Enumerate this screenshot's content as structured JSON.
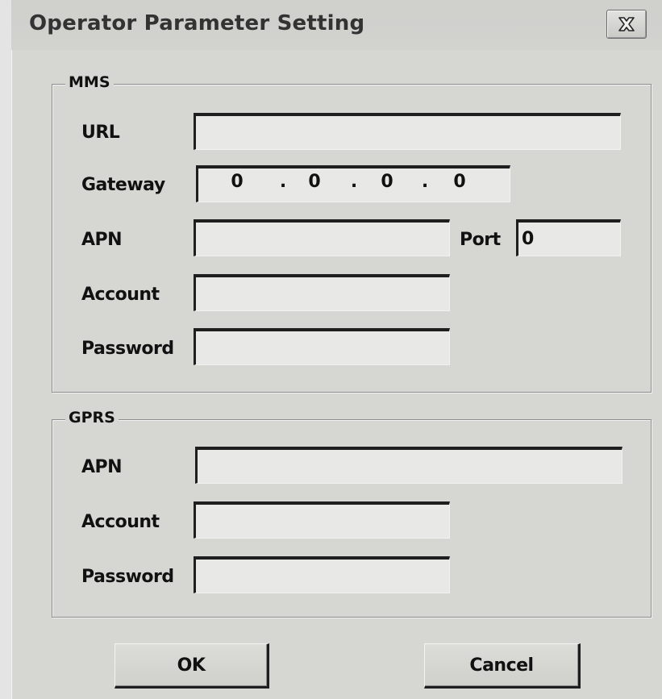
{
  "dialog": {
    "title": "Operator Parameter Setting"
  },
  "mms": {
    "legend": "MMS",
    "url_label": "URL",
    "url_value": "",
    "gateway_label": "Gateway",
    "gateway_octets": [
      "0",
      "0",
      "0",
      "0"
    ],
    "gateway_separator": ".",
    "apn_label": "APN",
    "apn_value": "",
    "port_label": "Port",
    "port_value": "0",
    "account_label": "Account",
    "account_value": "",
    "password_label": "Password",
    "password_value": ""
  },
  "gprs": {
    "legend": "GPRS",
    "apn_label": "APN",
    "apn_value": "",
    "account_label": "Account",
    "account_value": "",
    "password_label": "Password",
    "password_value": ""
  },
  "buttons": {
    "ok_label": "OK",
    "cancel_label": "Cancel"
  },
  "icons": {
    "close": "close-icon"
  }
}
